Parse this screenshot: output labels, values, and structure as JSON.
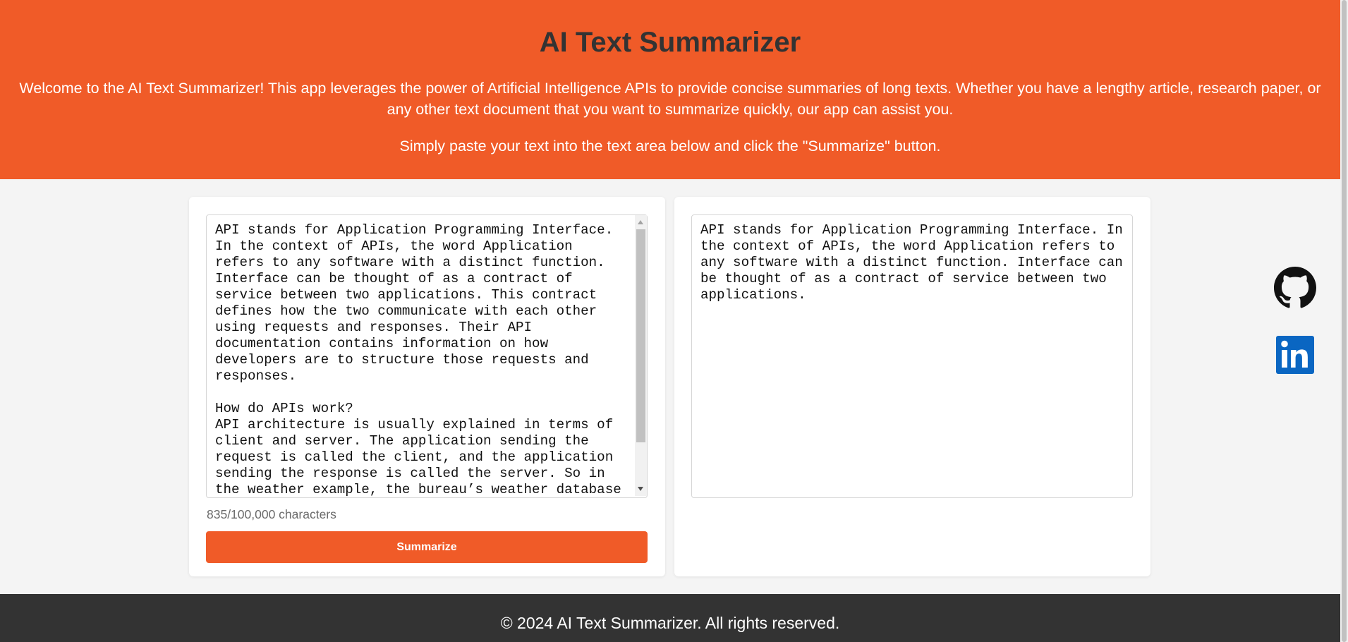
{
  "header": {
    "title": "AI Text Summarizer",
    "intro": "Welcome to the AI Text Summarizer! This app leverages the power of Artificial Intelligence APIs to provide concise summaries of long texts. Whether you have a lengthy article, research paper, or any other text document that you want to summarize quickly, our app can assist you.",
    "instruction": "Simply paste your text into the text area below and click the \"Summarize\" button."
  },
  "input_panel": {
    "text": "API stands for Application Programming Interface. In the context of APIs, the word Application refers to any software with a distinct function. Interface can be thought of as a contract of service between two applications. This contract defines how the two communicate with each other using requests and responses. Their API documentation contains information on how developers are to structure those requests and responses.\n\nHow do APIs work?\nAPI architecture is usually explained in terms of client and server. The application sending the request is called the client, and the application sending the response is called the server. So in the weather example, the bureau’s weather database is the server, and the mobile app is the client.",
    "char_count": "835/100,000 characters",
    "button_label": "Summarize"
  },
  "output_panel": {
    "text": "API stands for Application Programming Interface. In the context of APIs, the word Application refers to any software with a distinct function. Interface can be thought of as a contract of service between two applications."
  },
  "social": {
    "github_icon": "github-icon",
    "linkedin_icon": "linkedin-icon"
  },
  "footer": {
    "text": "© 2024 AI Text Summarizer. All rights reserved."
  },
  "colors": {
    "accent": "#f05b28",
    "title": "#333333",
    "footer_bg": "#333333",
    "linkedin": "#0a66c2"
  }
}
